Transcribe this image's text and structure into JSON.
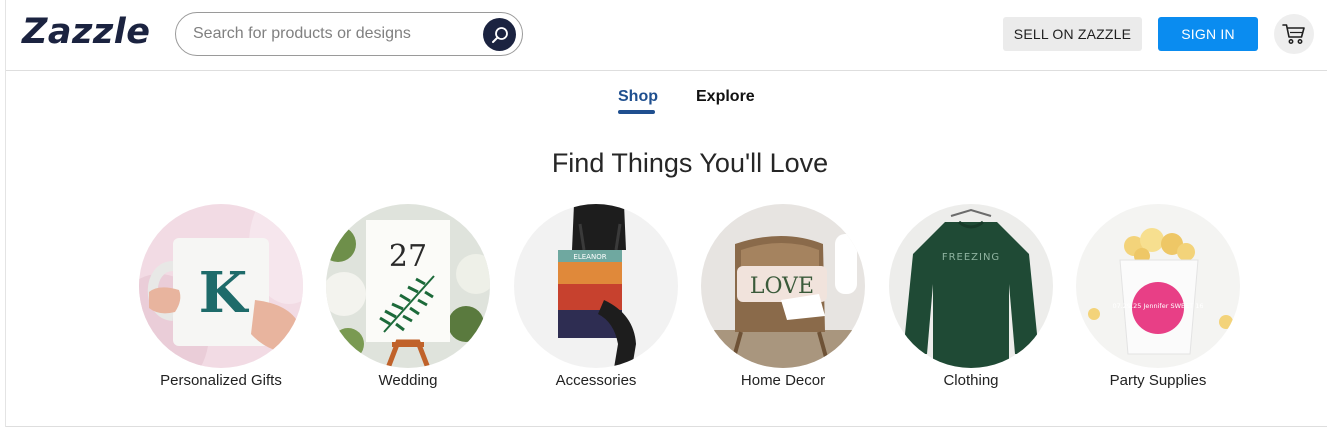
{
  "header": {
    "logo_text": "Zazzle",
    "search_placeholder": "Search for products or designs",
    "sell_label": "SELL ON ZAZZLE",
    "signin_label": "SIGN IN",
    "colors": {
      "brand_navy": "#1b2340",
      "signin_blue": "#0a8cf0",
      "tab_active": "#1f4f8f"
    }
  },
  "icons": {
    "search": "search-icon",
    "cart": "cart-icon"
  },
  "tabs": [
    {
      "label": "Shop",
      "active": true
    },
    {
      "label": "Explore",
      "active": false
    }
  ],
  "headline": "Find Things You'll Love",
  "categories": [
    {
      "label": "Personalized Gifts",
      "image_text": "K"
    },
    {
      "label": "Wedding",
      "image_text": "27"
    },
    {
      "label": "Accessories",
      "image_text": "ELEANOR"
    },
    {
      "label": "Home Decor",
      "image_text": "LOVE"
    },
    {
      "label": "Clothing",
      "image_text": "FREEZING"
    },
    {
      "label": "Party Supplies",
      "image_text": "07.29.25 Jennifer SWEET 16"
    }
  ]
}
